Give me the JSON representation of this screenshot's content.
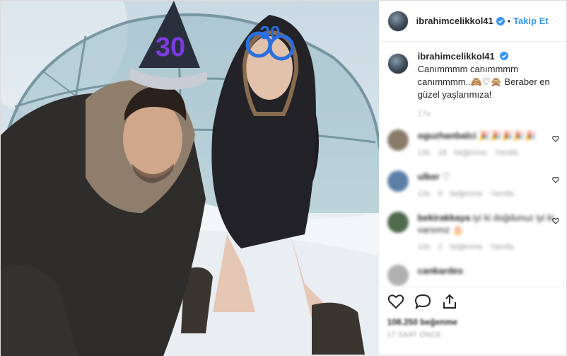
{
  "header": {
    "username": "ibrahimcelikkol41",
    "separator": "•",
    "follow_label": "Takip Et"
  },
  "caption": {
    "username": "ibrahimcelikkol41",
    "text": "Canımmmm canımmmm canımmmm..🙈♡🙊 Beraber en güzel yaşlarımıza!",
    "time": "17s"
  },
  "hat_number": "30",
  "glasses_number": "30",
  "comments": [
    {
      "username": "oguzhanbalci",
      "text": "🎉🎉🎉🎉🎉",
      "meta": "13s 18 beğenme Yanıtla",
      "avatar_color": "#8a7a6a"
    },
    {
      "username": "ulker",
      "text": "♡",
      "meta": "13s 9 beğenme Yanıtla",
      "avatar_color": "#5c7fa8"
    },
    {
      "username": "bekirakkaya",
      "text": "iyi ki doğdunuz iyi ki varsınız 🎂",
      "meta": "13s 2 beğenme Yanıtla",
      "avatar_color": "#4f6a4d"
    },
    {
      "username": "cankardes",
      "text": "",
      "meta": "",
      "avatar_color": "#b0b0b0"
    }
  ],
  "likes_text": "108.250 beğenme",
  "posted_text": "17 SAAT ÖNCE",
  "icons": {
    "verified": "verified-badge-icon",
    "like": "heart-icon",
    "comment": "comment-icon",
    "share": "share-icon",
    "comment_like": "heart-outline-icon"
  },
  "colors": {
    "link": "#3897f0",
    "verified": "#3897f0",
    "hat": "#2a2f3d",
    "glasses": "#2a6fe0"
  }
}
